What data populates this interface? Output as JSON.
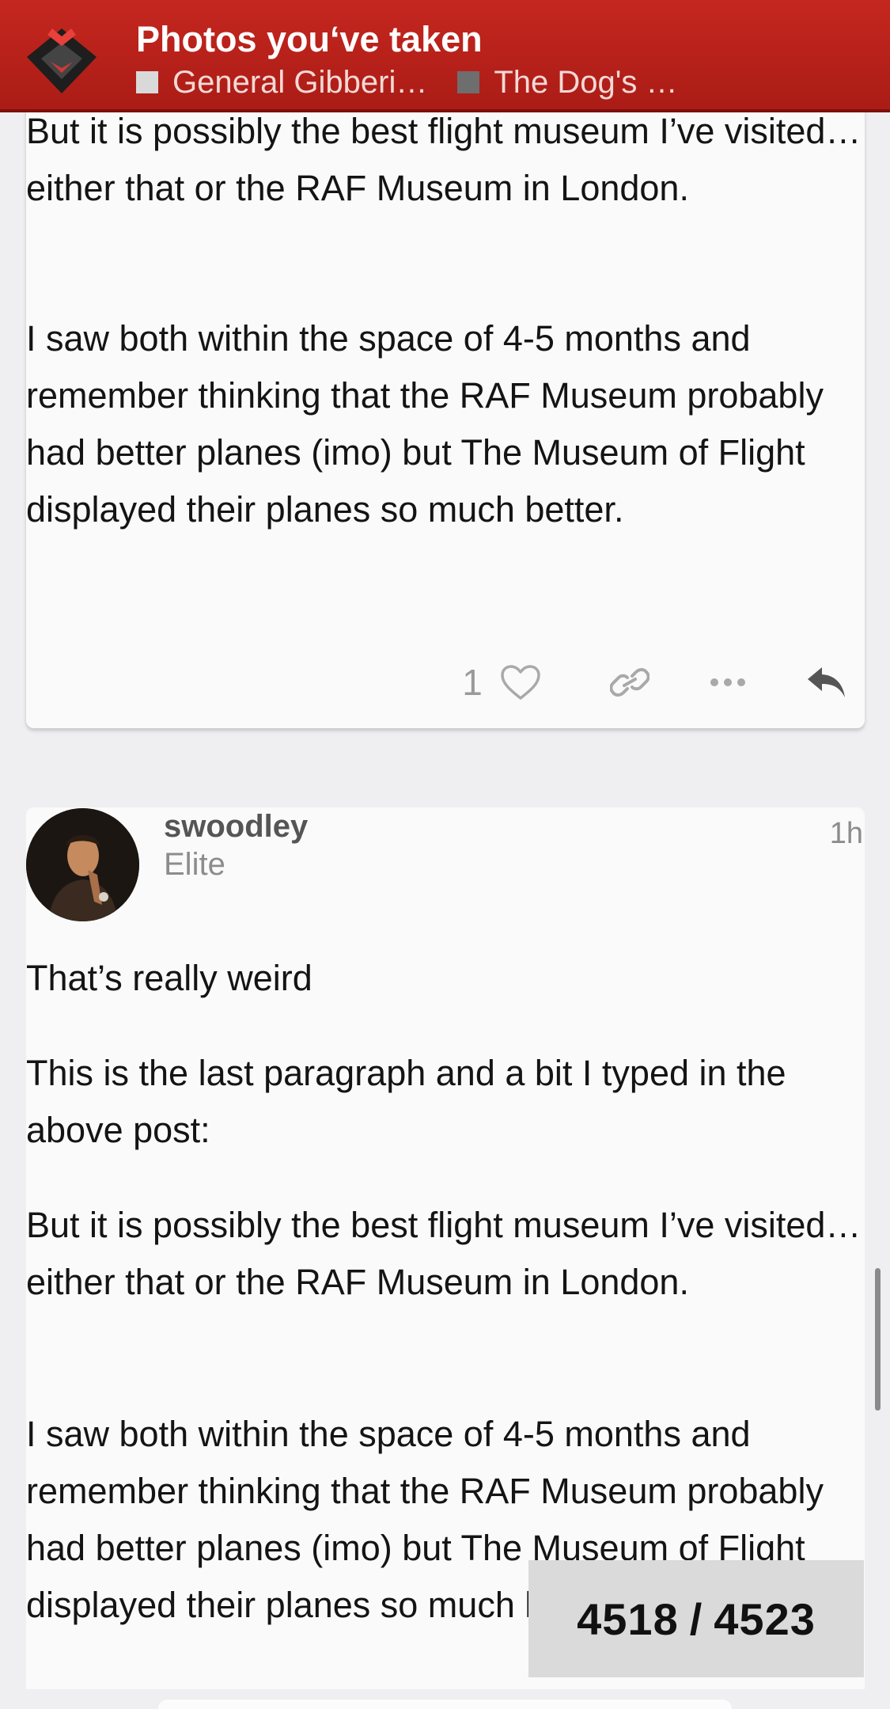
{
  "header": {
    "title": "Photos you‘ve taken",
    "breadcrumbs": [
      {
        "label": "General Gibberi…",
        "color": "#d9d9d9"
      },
      {
        "label": "The Dog's …",
        "color": "#6e6e6e"
      }
    ]
  },
  "post1": {
    "paragraphs": [
      "But it is possibly the best flight museum I’ve visited…either that or the RAF Museum in London.",
      "I saw both within the space of 4-5 months and remember thinking that the RAF Museum probably had better planes (imo) but The Museum of Flight displayed their planes so much better."
    ],
    "like_count": "1"
  },
  "post2": {
    "username": "swoodley",
    "user_title": "Elite",
    "time": "1h",
    "paragraphs": [
      "That’s really weird",
      "This is the last paragraph and a bit I typed in the above post:",
      "But it is possibly the best flight museum I’ve visited…either that or the RAF Museum in London.",
      "I saw both within the space of 4-5 months and remember thinking that the RAF Museum probably had better planes (imo) but The Museum of Flight displayed their planes so much better."
    ]
  },
  "progress": {
    "current": "4518",
    "separator": "/",
    "total": "4523"
  },
  "colors": {
    "header": "#b8221a",
    "accent": "#c4271f"
  },
  "icons": [
    "site-logo-icon",
    "heart-icon",
    "link-icon",
    "more-icon",
    "reply-icon"
  ]
}
